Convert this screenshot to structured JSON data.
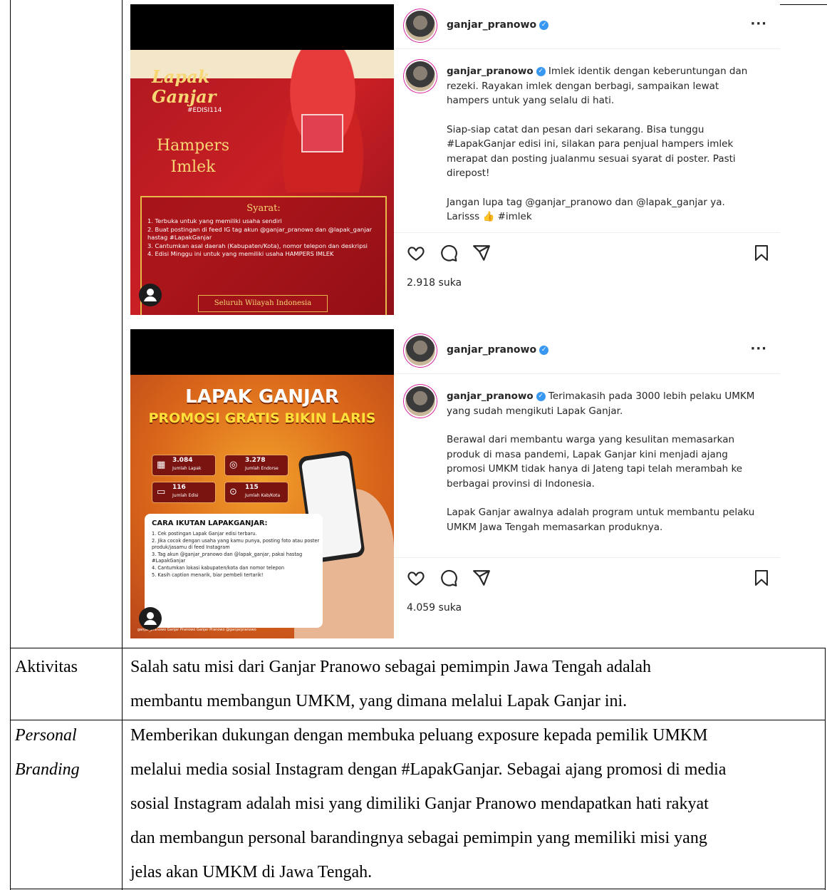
{
  "posts": [
    {
      "username": "ganjar_pranowo",
      "caption_paragraphs": [
        "Imlek identik dengan keberuntungan dan rezeki. Rayakan imlek dengan berbagi, sampaikan lewat hampers untuk yang selalu di hati.",
        "Siap-siap catat dan pesan dari sekarang. Bisa tunggu #LapakGanjar edisi ini, silakan para penjual hampers imlek merapat dan posting jualanmu sesuai syarat di poster. Pasti direpost!",
        "Jangan lupa tag @ganjar_pranowo dan @lapak_ganjar ya. Larisss 👍 #imlek"
      ],
      "likes": "2.918 suka",
      "poster": {
        "title": "Lapak Ganjar",
        "edition": "#EDISI114",
        "heading": "Hampers Imlek",
        "syarat_title": "Syarat:",
        "syarat": [
          "1. Terbuka untuk yang memiliki usaha sendiri",
          "2. Buat postingan di feed IG tag akun @ganjar_pranowo dan @lapak_ganjar hastag #LapakGanjar",
          "3. Cantumkan asal daerah (Kabupaten/Kota), nomor telepon dan deskripsi",
          "4. Edisi Minggu ini untuk yang memiliki usaha HAMPERS IMLEK"
        ],
        "footer": "Seluruh Wilayah Indonesia"
      }
    },
    {
      "username": "ganjar_pranowo",
      "caption_paragraphs": [
        "Terimakasih pada 3000 lebih pelaku UMKM yang sudah mengikuti Lapak Ganjar.",
        "Berawal dari membantu warga yang kesulitan memasarkan produk di masa pandemi, Lapak Ganjar kini menjadi ajang promosi UMKM tidak hanya di Jateng tapi telah merambah ke berbagai provinsi di Indonesia.",
        "Lapak Ganjar awalnya adalah program untuk membantu pelaku UMKM Jawa Tengah memasarkan produknya."
      ],
      "likes": "4.059 suka",
      "poster": {
        "title": "LAPAK GANJAR",
        "subtitle": "PROMOSI GRATIS BIKIN LARIS",
        "stats": [
          {
            "value": "3.084",
            "label": "Jumlah Lapak",
            "icon": "store-icon"
          },
          {
            "value": "3.278",
            "label": "Jumlah Endorse",
            "icon": "instagram-icon"
          },
          {
            "value": "116",
            "label": "Jumlah Edisi",
            "icon": "calendar-icon"
          },
          {
            "value": "115",
            "label": "Jumlah Kab/Kota",
            "icon": "location-pin-icon"
          }
        ],
        "cara_title": "CARA IKUTAN LAPAKGANJAR:",
        "cara": [
          "1. Cek postingan Lapak Ganjar edisi terbaru.",
          "2. Jika cocok dengan usaha yang kamu punya, posting foto atau poster produk/jasamu di feed Instagram",
          "3. Tag akun @ganjar_pranowo dan @lapak_ganjar, pakai hastag #LapakGanjar",
          "4. Cantumkan lokasi kabupaten/kota dan nomor telepon",
          "5. Kasih caption menarik, biar pembeli tertarik!"
        ],
        "footer": "ganjar_pranowo  Ganjar Pranowo  Ganjar Pranowo  @ganjarpranowo"
      }
    }
  ],
  "rows": [
    {
      "label": "Aktivitas",
      "lines": [
        "Salah satu misi dari Ganjar Pranowo sebagai pemimpin Jawa Tengah adalah",
        "membantu membangun UMKM, yang dimana melalui Lapak Ganjar ini."
      ]
    },
    {
      "label_lines": [
        "Personal",
        "Branding"
      ],
      "lines": [
        "Memberikan dukungan dengan membuka peluang exposure kepada pemilik UMKM",
        "melalui media sosial Instagram dengan #LapakGanjar. Sebagai ajang promosi di media",
        "sosial Instagram adalah misi yang dimiliki Ganjar Pranowo mendapatkan hati rakyat",
        "dan membangun personal barandingnya sebagai pemimpin yang memiliki misi yang",
        "jelas akan UMKM di Jawa Tengah."
      ]
    }
  ]
}
